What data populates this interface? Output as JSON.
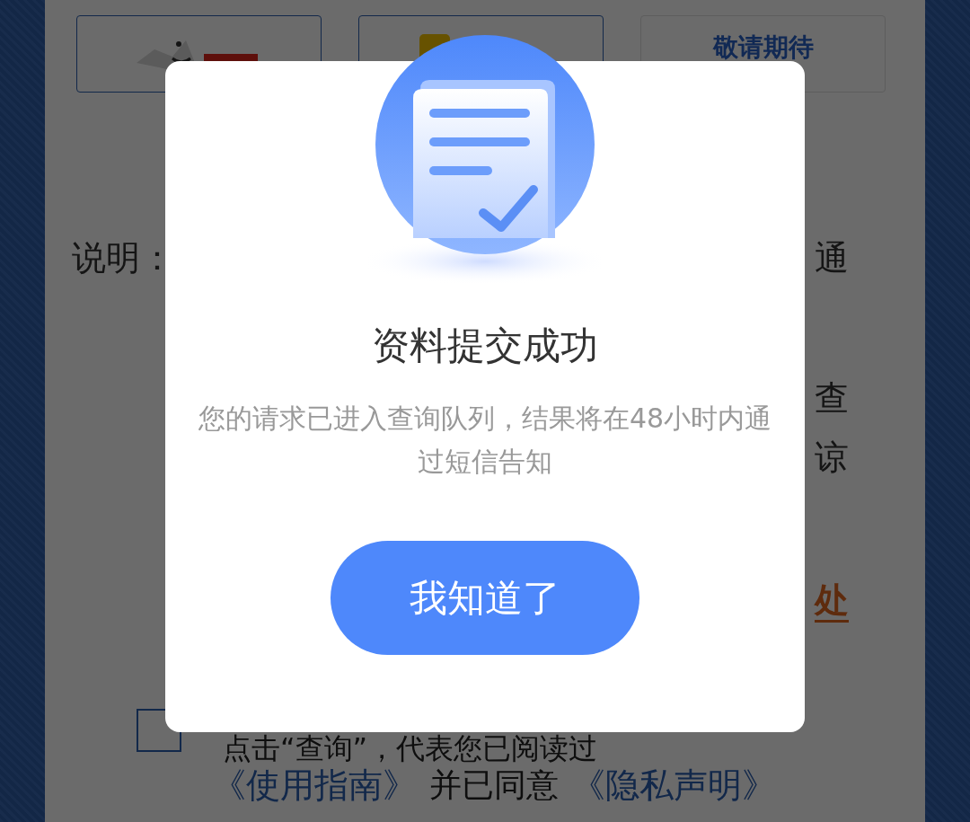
{
  "cards": [
    {
      "kind": "jd"
    },
    {
      "kind": "yellow"
    },
    {
      "kind": "text",
      "label": "敬请期待"
    }
  ],
  "notes": [
    {
      "left": "说明：",
      "right": "通",
      "kind": "plain"
    },
    {
      "right": "查",
      "kind": "plain"
    },
    {
      "right": "谅",
      "kind": "plain"
    },
    {
      "right": "处",
      "kind": "link"
    }
  ],
  "agreement": {
    "checked": false,
    "line_1": "点击“查询”，代表您已阅读过",
    "line_2": [
      {
        "text": "《使用指南》",
        "kind": "link"
      },
      {
        "text": "并已同意",
        "kind": "plain"
      },
      {
        "text": "《隐私声明》",
        "kind": "link"
      }
    ]
  },
  "dialog": {
    "title": "资料提交成功",
    "message": "您的请求已进入查询队列，结果将在48小时内通过短信告知",
    "button": "我知道了"
  }
}
